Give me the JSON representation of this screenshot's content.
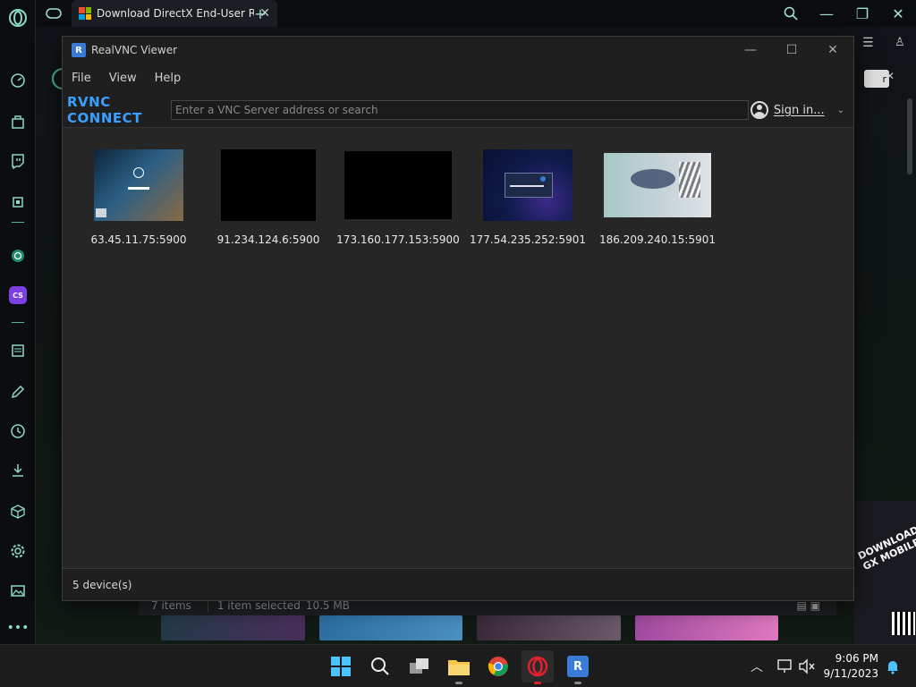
{
  "browser": {
    "tab_title": "Download DirectX End-User Runtime",
    "sidebar_icons": [
      "speedometer-icon",
      "bag-icon",
      "twitch-icon",
      "hardware-icon",
      "chatgpt-icon",
      "cs-icon",
      "news-icon",
      "pencil-icon",
      "history-icon",
      "download-icon",
      "box-icon",
      "settings-icon",
      "gallery-icon",
      "more-icon"
    ],
    "cs_label": "CS",
    "ad_text": "DOWNLOAD OPERA GX MOBILE",
    "files_status": {
      "items": "7 items",
      "selected": "1 item selected",
      "size": "10.5 MB"
    },
    "colors": {
      "accent": "#49b598",
      "background": "#0e1114"
    }
  },
  "vnc": {
    "window_title": "RealVNC Viewer",
    "menu": [
      "File",
      "View",
      "Help"
    ],
    "brand": "RVNC CONNECT",
    "search_placeholder": "Enter a VNC Server address or search",
    "sign_in_label": "Sign in...",
    "devices": [
      {
        "address": "63.45.11.75:5900",
        "thumb": "windows-lockscreen"
      },
      {
        "address": "91.234.124.6:5900",
        "thumb": "black"
      },
      {
        "address": "173.160.177.153:5900",
        "thumb": "black"
      },
      {
        "address": "177.54.235.252:5901",
        "thumb": "blue-dialog"
      },
      {
        "address": "186.209.240.15:5901",
        "thumb": "distorted"
      }
    ],
    "status": "5 device(s)",
    "accent_color": "#3aa0ff"
  },
  "taskbar": {
    "apps": [
      "windows-start-icon",
      "search-icon",
      "task-view-icon",
      "file-explorer-icon",
      "chrome-icon",
      "opera-gx-icon",
      "realvnc-icon"
    ],
    "time": "9:06 PM",
    "date": "9/11/2023"
  }
}
